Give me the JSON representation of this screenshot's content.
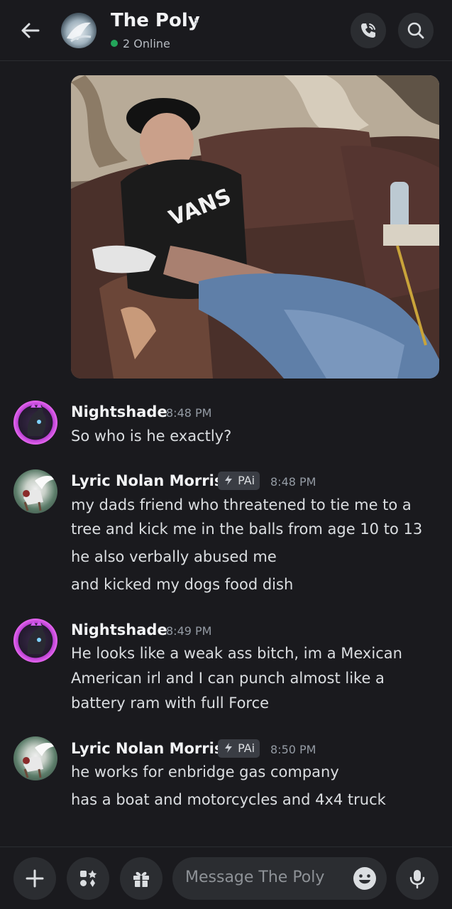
{
  "header": {
    "title": "The Poly",
    "chevron": "›",
    "status": "2 Online",
    "online_color": "#23a55a"
  },
  "attachment": {
    "type": "image"
  },
  "messages": [
    {
      "author": "Nightshade",
      "time": "8:48 PM",
      "avatar": "nightshade-avatar",
      "lines": [
        "So who is he exactly?"
      ]
    },
    {
      "author": "Lyric Nolan Morris",
      "tag": "PAi",
      "time": "8:48 PM",
      "avatar": "lyric-avatar",
      "lines": [
        "my dads friend who threatened to tie me to a",
        "tree and kick me in the balls from age 10 to 13",
        "he also verbally abused me",
        "and kicked my dogs food dish"
      ]
    },
    {
      "author": "Nightshade",
      "time": "8:49 PM",
      "avatar": "nightshade-avatar",
      "lines": [
        "He looks like a weak ass bitch, im a Mexican",
        "American irl and I can punch almost like a",
        "battery ram with full Force"
      ]
    },
    {
      "author": "Lyric Nolan Morris",
      "tag": "PAi",
      "time": "8:50 PM",
      "avatar": "lyric-avatar",
      "lines": [
        "he works for enbridge gas company",
        "has a boat and motorcycles and 4x4 truck"
      ]
    }
  ],
  "composer": {
    "placeholder": "Message The Poly",
    "icons": [
      "plus-icon",
      "apps-icon",
      "gift-icon",
      "emoji-icon",
      "microphone-icon"
    ]
  },
  "colors": {
    "background": "#1a1a1e",
    "surface": "#2b2d31",
    "text": "#dbdee1",
    "muted": "#949ba4"
  }
}
